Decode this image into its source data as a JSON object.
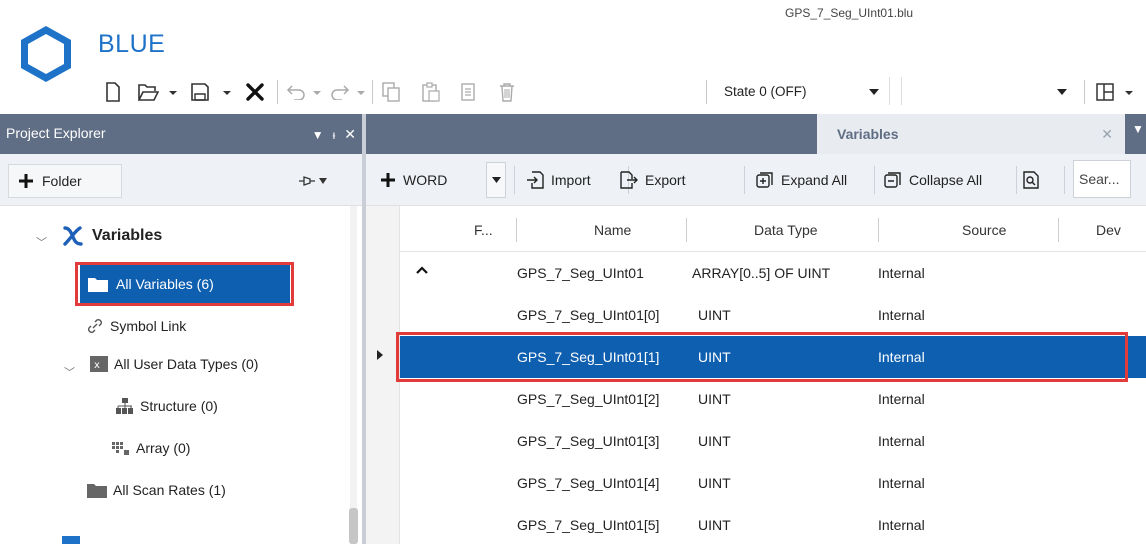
{
  "window": {
    "app_name": "BLUE",
    "file_title": "GPS_7_Seg_UInt01.blu"
  },
  "toolbar": {
    "icons": [
      "new-file-icon",
      "open-file-icon",
      "save-icon",
      "delete-x-icon",
      "undo-icon",
      "redo-icon",
      "copy-icon",
      "paste-icon",
      "paste-special-icon",
      "trash-icon",
      "layout-icon"
    ],
    "state_value": "State 0 (OFF)",
    "second_combo_value": ""
  },
  "explorer": {
    "title": "Project Explorer",
    "folder_button": "Folder",
    "tree": {
      "variables": "Variables",
      "all_variables": "All Variables (6)",
      "symbol_link": "Symbol Link",
      "all_user_data_types": "All User Data Types (0)",
      "structure": "Structure (0)",
      "array": "Array (0)",
      "all_scan_rates": "All Scan Rates (1)"
    }
  },
  "document": {
    "tab_title": "Variables",
    "toolbar": {
      "word_label": "WORD",
      "import_label": "Import",
      "export_label": "Export",
      "expand_all_label": "Expand All",
      "collapse_all_label": "Collapse All",
      "search_placeholder": "Sear..."
    },
    "columns": [
      "F...",
      "Name",
      "Data Type",
      "Source",
      "Dev"
    ],
    "rows": [
      {
        "name": "GPS_7_Seg_UInt01",
        "type": "ARRAY[0..5] OF UINT",
        "source": "Internal"
      },
      {
        "name": "GPS_7_Seg_UInt01[0]",
        "type": "UINT",
        "source": "Internal"
      },
      {
        "name": "GPS_7_Seg_UInt01[1]",
        "type": "UINT",
        "source": "Internal"
      },
      {
        "name": "GPS_7_Seg_UInt01[2]",
        "type": "UINT",
        "source": "Internal"
      },
      {
        "name": "GPS_7_Seg_UInt01[3]",
        "type": "UINT",
        "source": "Internal"
      },
      {
        "name": "GPS_7_Seg_UInt01[4]",
        "type": "UINT",
        "source": "Internal"
      },
      {
        "name": "GPS_7_Seg_UInt01[5]",
        "type": "UINT",
        "source": "Internal"
      }
    ],
    "selected_row": 2
  },
  "colors": {
    "accent": "#0e5fb0",
    "panel_header": "#5f6e84",
    "highlight": "#e23b3b"
  }
}
